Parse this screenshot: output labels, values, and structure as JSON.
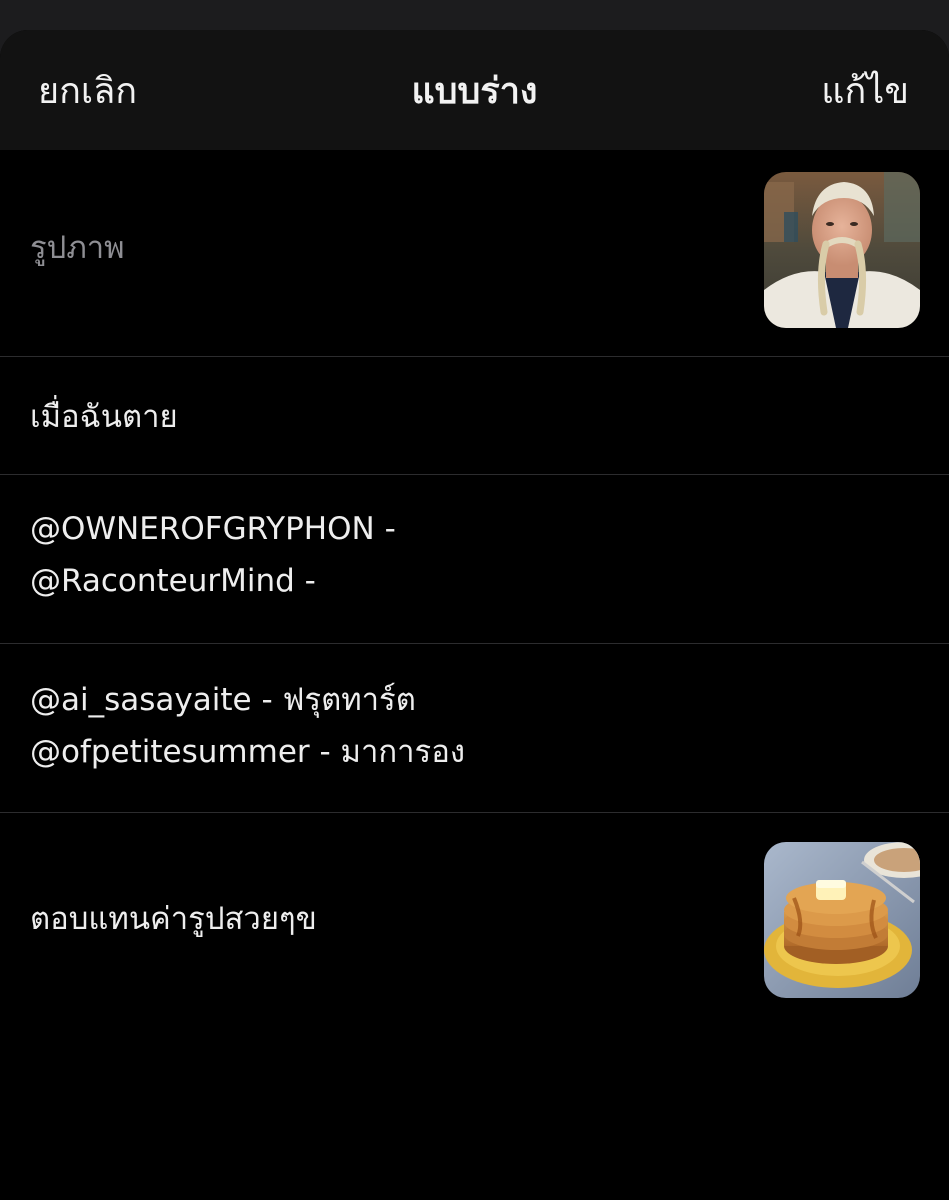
{
  "navbar": {
    "cancel_label": "ยกเลิก",
    "title": "แบบร่าง",
    "edit_label": "แก้ไข"
  },
  "drafts": [
    {
      "lines": [
        "รูปภาพ"
      ],
      "muted": true,
      "thumbnail": "viking-portrait"
    },
    {
      "lines": [
        "เมื่อฉันตาย"
      ]
    },
    {
      "lines": [
        "@OWNEROFGRYPHON -",
        "@RaconteurMind -"
      ]
    },
    {
      "lines": [
        "@ai_sasayaite - ฟรุตทาร์ต",
        "@ofpetitesummer - มาการอง"
      ]
    },
    {
      "lines": [
        "ตอบแทนค่ารูปสวยๆข"
      ],
      "thumbnail": "pancake-stack"
    }
  ],
  "colors": {
    "background": "#000000",
    "navbar": "#121212",
    "separator": "#2c2c2e",
    "text": "#eeeeee",
    "muted_text": "#8e8e93"
  }
}
